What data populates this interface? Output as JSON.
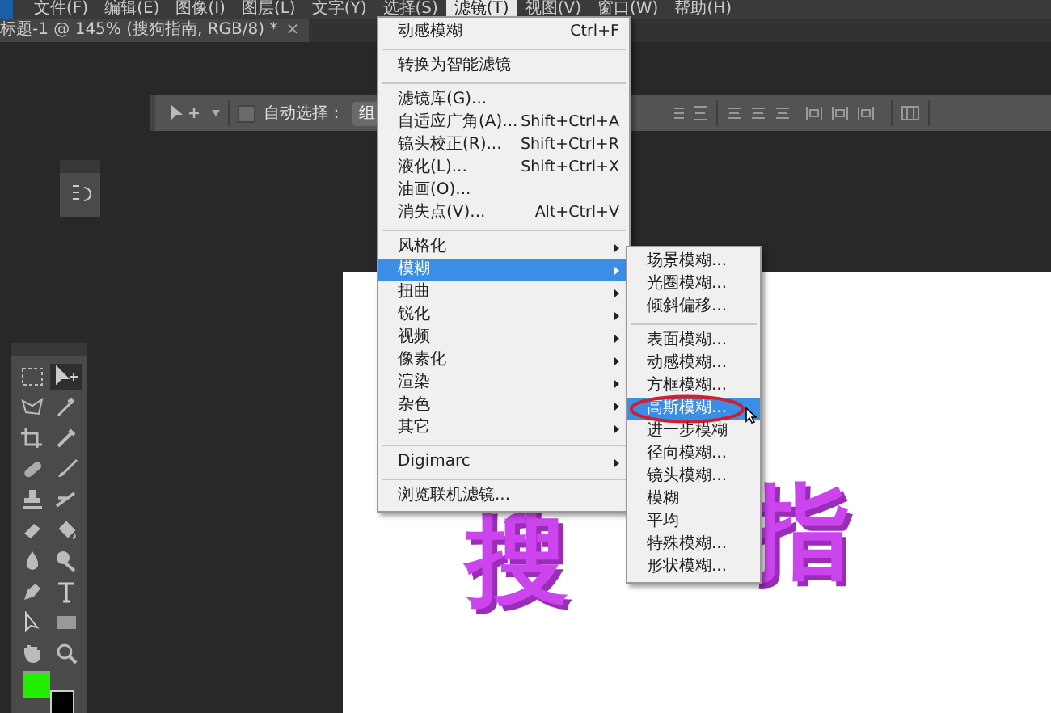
{
  "menu_bar": {
    "items": [
      {
        "label": "文件(F)",
        "selected": false
      },
      {
        "label": "编辑(E)",
        "selected": false
      },
      {
        "label": "图像(I)",
        "selected": false
      },
      {
        "label": "图层(L)",
        "selected": false
      },
      {
        "label": "文字(Y)",
        "selected": false
      },
      {
        "label": "选择(S)",
        "selected": false
      },
      {
        "label": "滤镜(T)",
        "selected": true
      },
      {
        "label": "视图(V)",
        "selected": false
      },
      {
        "label": "窗口(W)",
        "selected": false
      },
      {
        "label": "帮助(H)",
        "selected": false
      }
    ]
  },
  "document_tab": {
    "title": "标题-1 @ 145% (搜狗指南, RGB/8) *",
    "close": "×"
  },
  "options_bar": {
    "auto_select": {
      "label": "自动选择：",
      "checked": false
    },
    "target": "组"
  },
  "canvas": {
    "texts": [
      {
        "text": "搜"
      },
      {
        "text": "指"
      }
    ]
  },
  "filter_menu": {
    "items": [
      {
        "kind": "item",
        "label": "动感模糊",
        "shortcut": "Ctrl+F",
        "selected": false,
        "submenu": false
      },
      {
        "kind": "separator"
      },
      {
        "kind": "item",
        "label": "转换为智能滤镜",
        "selected": false,
        "submenu": false
      },
      {
        "kind": "separator"
      },
      {
        "kind": "item",
        "label": "滤镜库(G)...",
        "selected": false,
        "submenu": false
      },
      {
        "kind": "item",
        "label": "自适应广角(A)...",
        "shortcut": "Shift+Ctrl+A",
        "selected": false,
        "submenu": false
      },
      {
        "kind": "item",
        "label": "镜头校正(R)...",
        "shortcut": "Shift+Ctrl+R",
        "selected": false,
        "submenu": false
      },
      {
        "kind": "item",
        "label": "液化(L)...",
        "shortcut": "Shift+Ctrl+X",
        "selected": false,
        "submenu": false
      },
      {
        "kind": "item",
        "label": "油画(O)...",
        "selected": false,
        "submenu": false
      },
      {
        "kind": "item",
        "label": "消失点(V)...",
        "shortcut": "Alt+Ctrl+V",
        "selected": false,
        "submenu": false
      },
      {
        "kind": "separator"
      },
      {
        "kind": "item",
        "label": "风格化",
        "selected": false,
        "submenu": true
      },
      {
        "kind": "item",
        "label": "模糊",
        "selected": true,
        "submenu": true
      },
      {
        "kind": "item",
        "label": "扭曲",
        "selected": false,
        "submenu": true
      },
      {
        "kind": "item",
        "label": "锐化",
        "selected": false,
        "submenu": true
      },
      {
        "kind": "item",
        "label": "视频",
        "selected": false,
        "submenu": true
      },
      {
        "kind": "item",
        "label": "像素化",
        "selected": false,
        "submenu": true
      },
      {
        "kind": "item",
        "label": "渲染",
        "selected": false,
        "submenu": true
      },
      {
        "kind": "item",
        "label": "杂色",
        "selected": false,
        "submenu": true
      },
      {
        "kind": "item",
        "label": "其它",
        "selected": false,
        "submenu": true
      },
      {
        "kind": "separator"
      },
      {
        "kind": "item",
        "label": "Digimarc",
        "selected": false,
        "submenu": true
      },
      {
        "kind": "separator"
      },
      {
        "kind": "item",
        "label": "浏览联机滤镜...",
        "selected": false,
        "submenu": false
      }
    ]
  },
  "blur_submenu": {
    "items": [
      {
        "kind": "item",
        "label": "场景模糊...",
        "selected": false,
        "circled": false
      },
      {
        "kind": "item",
        "label": "光圈模糊...",
        "selected": false,
        "circled": false
      },
      {
        "kind": "item",
        "label": "倾斜偏移...",
        "selected": false,
        "circled": false
      },
      {
        "kind": "separator"
      },
      {
        "kind": "item",
        "label": "表面模糊...",
        "selected": false,
        "circled": false
      },
      {
        "kind": "item",
        "label": "动感模糊...",
        "selected": false,
        "circled": false
      },
      {
        "kind": "item",
        "label": "方框模糊...",
        "selected": false,
        "circled": false
      },
      {
        "kind": "item",
        "label": "高斯模糊...",
        "selected": true,
        "circled": true
      },
      {
        "kind": "item",
        "label": "进一步模糊",
        "selected": false,
        "circled": false
      },
      {
        "kind": "item",
        "label": "径向模糊...",
        "selected": false,
        "circled": false
      },
      {
        "kind": "item",
        "label": "镜头模糊...",
        "selected": false,
        "circled": false
      },
      {
        "kind": "item",
        "label": "模糊",
        "selected": false,
        "circled": false
      },
      {
        "kind": "item",
        "label": "平均",
        "selected": false,
        "circled": false
      },
      {
        "kind": "item",
        "label": "特殊模糊...",
        "selected": false,
        "circled": false
      },
      {
        "kind": "item",
        "label": "形状模糊...",
        "selected": false,
        "circled": false
      }
    ]
  }
}
